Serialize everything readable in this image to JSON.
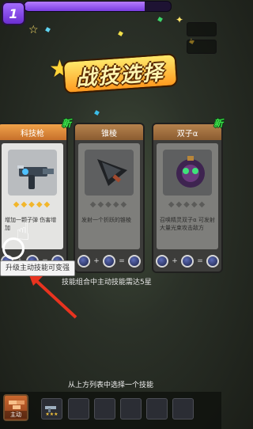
{
  "hud": {
    "level": "1",
    "xp_progress": 0.82
  },
  "title": {
    "text": "战技选择"
  },
  "cards": [
    {
      "name": "科技枪",
      "new_label": "新",
      "stars": "◆◆◆◆◆",
      "description": "增加一颗子弹 伤害增加",
      "icon": "gun-icon"
    },
    {
      "name": "锥棱",
      "new_label": "",
      "stars": "◆◆◆◆◆",
      "description": "发射一个折跃的锥棱",
      "icon": "drill-icon"
    },
    {
      "name": "双子α",
      "new_label": "新",
      "stars": "◆◆◆◆◆",
      "description": "召唤精灵双子α 可发射大量光束攻击敌方",
      "icon": "twin-sprite-icon"
    }
  ],
  "combo_ops": {
    "plus": "+",
    "equals": "="
  },
  "tooltip": "升级主动技能可变强",
  "hint": "技能组合中主动技能需达5星",
  "prompt": "从上方列表中选择一个技能",
  "bottom_bar": {
    "active_slot_label": "主动",
    "skill_stars": "★★★",
    "slot_count": 6
  },
  "colors": {
    "accent_orange": "#e8913f",
    "new_green": "#3ce54b",
    "xp_purple": "#8a49ea"
  }
}
